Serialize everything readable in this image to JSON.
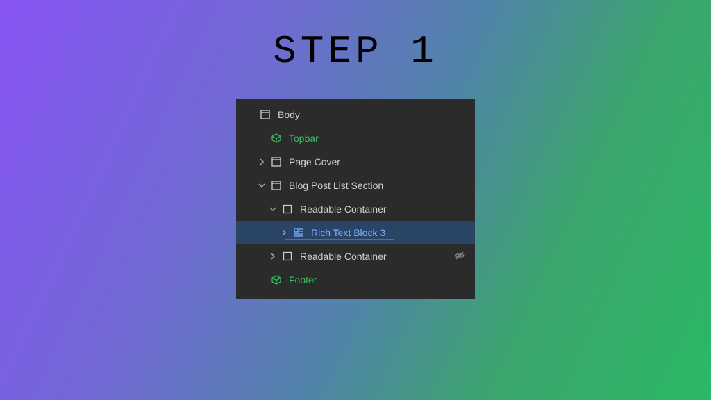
{
  "heading": "STEP 1",
  "tree": {
    "body": {
      "label": "Body"
    },
    "topbar": {
      "label": "Topbar"
    },
    "pageCover": {
      "label": "Page Cover"
    },
    "blogSection": {
      "label": "Blog Post List Section"
    },
    "readable1": {
      "label": "Readable Container"
    },
    "richText": {
      "label": "Rich Text Block 3"
    },
    "readable2": {
      "label": "Readable Container"
    },
    "footer": {
      "label": "Footer"
    }
  },
  "colors": {
    "accentGreen": "#3bbd62",
    "accentBlue": "#7cb1ff",
    "underlineRed": "#e3372f"
  }
}
